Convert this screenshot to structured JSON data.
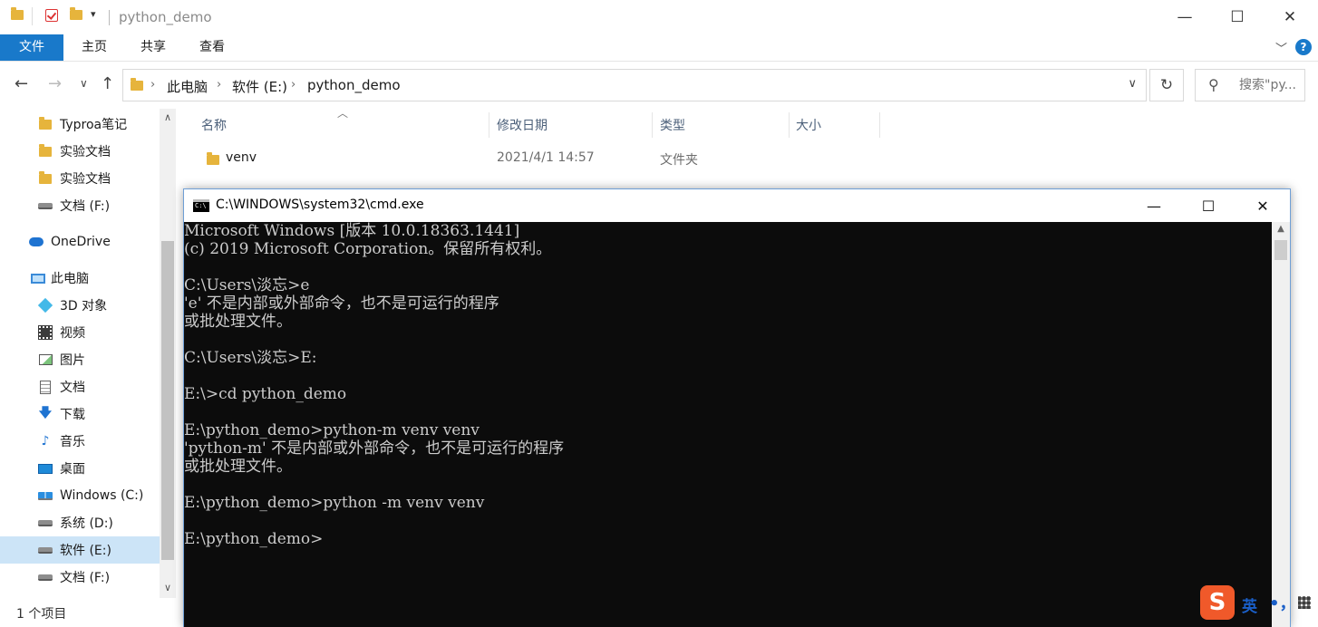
{
  "explorer": {
    "title": "python_demo",
    "window_controls": {
      "minimize": "—",
      "maximize": "☐",
      "close": "✕"
    },
    "ribbon": {
      "tabs": [
        {
          "label": "文件"
        },
        {
          "label": "主页"
        },
        {
          "label": "共享"
        },
        {
          "label": "查看"
        }
      ],
      "expand_icon": "chevron-down-icon",
      "help_label": "?"
    },
    "address": {
      "crumbs": [
        "此电脑",
        "软件 (E:)",
        "python_demo"
      ]
    },
    "search": {
      "placeholder": "搜索\"py..."
    },
    "nav_pane": {
      "items": [
        {
          "label": "Typroa笔记",
          "icon": "folder-icon"
        },
        {
          "label": "实验文档",
          "icon": "folder-icon"
        },
        {
          "label": "实验文档",
          "icon": "folder-icon"
        },
        {
          "label": "文档 (F:)",
          "icon": "drive-icon"
        },
        {
          "label": "OneDrive",
          "icon": "cloud-icon"
        },
        {
          "label": "此电脑",
          "icon": "computer-icon"
        },
        {
          "label": "3D 对象",
          "icon": "cube-icon"
        },
        {
          "label": "视频",
          "icon": "film-icon"
        },
        {
          "label": "图片",
          "icon": "picture-icon"
        },
        {
          "label": "文档",
          "icon": "document-icon"
        },
        {
          "label": "下载",
          "icon": "download-icon"
        },
        {
          "label": "音乐",
          "icon": "music-icon"
        },
        {
          "label": "桌面",
          "icon": "desktop-icon"
        },
        {
          "label": "Windows (C:)",
          "icon": "windows-drive-icon"
        },
        {
          "label": "系统 (D:)",
          "icon": "drive-icon"
        },
        {
          "label": "软件 (E:)",
          "icon": "drive-icon",
          "selected": true
        },
        {
          "label": "文档 (F:)",
          "icon": "drive-icon"
        }
      ]
    },
    "file_list": {
      "columns": [
        "名称",
        "修改日期",
        "类型",
        "大小"
      ],
      "rows": [
        {
          "name": "venv",
          "modified": "2021/4/1 14:57",
          "type": "文件夹",
          "size": ""
        }
      ]
    },
    "status": "1 个项目"
  },
  "cmd": {
    "title": "C:\\WINDOWS\\system32\\cmd.exe",
    "icon_text": "C:\\",
    "window_controls": {
      "minimize": "—",
      "maximize": "☐",
      "close": "✕"
    },
    "lines": [
      "Microsoft Windows [版本 10.0.18363.1441]",
      "(c) 2019 Microsoft Corporation。保留所有权利。",
      "",
      "C:\\Users\\淡忘>e",
      "'e' 不是内部或外部命令，也不是可运行的程序",
      "或批处理文件。",
      "",
      "C:\\Users\\淡忘>E:",
      "",
      "E:\\>cd python_demo",
      "",
      "E:\\python_demo>python-m venv venv",
      "'python-m' 不是内部或外部命令，也不是可运行的程序",
      "或批处理文件。",
      "",
      "E:\\python_demo>python -m venv venv",
      "",
      "E:\\python_demo>"
    ]
  },
  "ime": {
    "logo": "S",
    "mode": "英",
    "punct": "•，"
  },
  "colors": {
    "accent": "#1979ca",
    "selection": "#cce4f7",
    "console_bg": "#0c0c0c",
    "console_fg": "#cccccc",
    "ime_logo": "#f0592a"
  }
}
